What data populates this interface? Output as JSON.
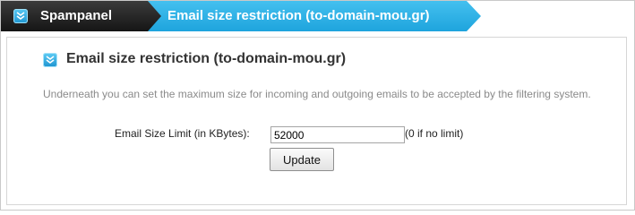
{
  "header": {
    "breadcrumb_root": "Spampanel",
    "breadcrumb_current": "Email size restriction (to-domain-mou.gr)",
    "root_icon": "chevron-down-icon",
    "colors": {
      "dark": "#1f1f1f",
      "accent": "#2fb2e8"
    }
  },
  "section": {
    "icon": "chevron-down-icon",
    "title": "Email size restriction (to-domain-mou.gr)",
    "description": "Underneath you can set the maximum size for incoming and outgoing emails to be accepted by the filtering system."
  },
  "form": {
    "label": "Email Size Limit (in KBytes):",
    "value": "52000",
    "hint": "(0 if no limit)",
    "submit_label": "Update"
  }
}
